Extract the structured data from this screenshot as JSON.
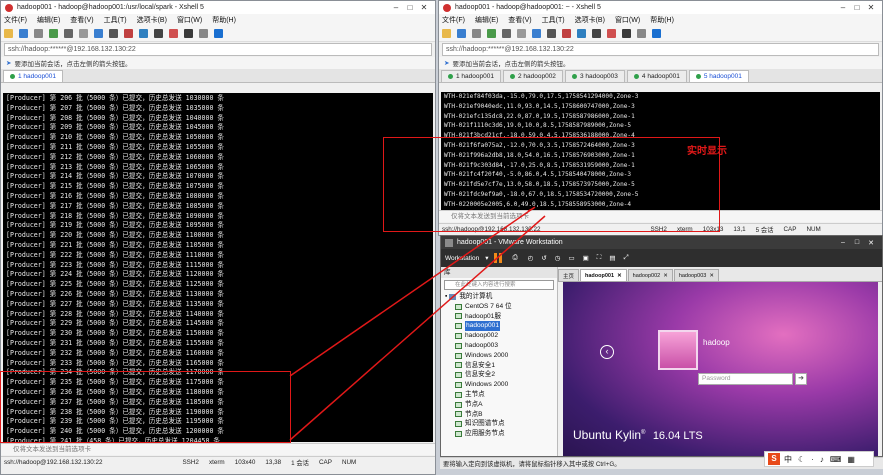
{
  "left_window": {
    "title": "hadoop001 - hadoop@hadoop001:/usr/local/spark - Xshell 5",
    "menu": [
      "文件(F)",
      "编辑(E)",
      "查看(V)",
      "工具(T)",
      "选项卡(B)",
      "窗口(W)",
      "帮助(H)"
    ],
    "address": "ssh://hadoop:******@192.168.132.130:22",
    "hint": "要添加当前会话，点击左侧的箭头按钮。",
    "tab_label": "1 hadoop001",
    "lines": [
      "[Producer] 第 206 批（5000 条）已提交，历史总发送 1030000 条",
      "[Producer] 第 207 批（5000 条）已提交，历史总发送 1035000 条",
      "[Producer] 第 208 批（5000 条）已提交，历史总发送 1040000 条",
      "[Producer] 第 209 批（5000 条）已提交，历史总发送 1045000 条",
      "[Producer] 第 210 批（5000 条）已提交，历史总发送 1050000 条",
      "[Producer] 第 211 批（5000 条）已提交，历史总发送 1055000 条",
      "[Producer] 第 212 批（5000 条）已提交，历史总发送 1060000 条",
      "[Producer] 第 213 批（5000 条）已提交，历史总发送 1065000 条",
      "[Producer] 第 214 批（5000 条）已提交，历史总发送 1070000 条",
      "[Producer] 第 215 批（5000 条）已提交，历史总发送 1075000 条",
      "[Producer] 第 216 批（5000 条）已提交，历史总发送 1080000 条",
      "[Producer] 第 217 批（5000 条）已提交，历史总发送 1085000 条",
      "[Producer] 第 218 批（5000 条）已提交，历史总发送 1090000 条",
      "[Producer] 第 219 批（5000 条）已提交，历史总发送 1095000 条",
      "[Producer] 第 220 批（5000 条）已提交，历史总发送 1100000 条",
      "[Producer] 第 221 批（5000 条）已提交，历史总发送 1105000 条",
      "[Producer] 第 222 批（5000 条）已提交，历史总发送 1110000 条",
      "[Producer] 第 223 批（5000 条）已提交，历史总发送 1115000 条",
      "[Producer] 第 224 批（5000 条）已提交，历史总发送 1120000 条",
      "[Producer] 第 225 批（5000 条）已提交，历史总发送 1125000 条",
      "[Producer] 第 226 批（5000 条）已提交，历史总发送 1130000 条",
      "[Producer] 第 227 批（5000 条）已提交，历史总发送 1135000 条",
      "[Producer] 第 228 批（5000 条）已提交，历史总发送 1140000 条",
      "[Producer] 第 229 批（5000 条）已提交，历史总发送 1145000 条",
      "[Producer] 第 230 批（5000 条）已提交，历史总发送 1150000 条",
      "[Producer] 第 231 批（5000 条）已提交，历史总发送 1155000 条",
      "[Producer] 第 232 批（5000 条）已提交，历史总发送 1160000 条",
      "[Producer] 第 233 批（5000 条）已提交，历史总发送 1165000 条",
      "[Producer] 第 234 批（5000 条）已提交，历史总发送 1170000 条",
      "[Producer] 第 235 批（5000 条）已提交，历史总发送 1175000 条",
      "[Producer] 第 236 批（5000 条）已提交，历史总发送 1180000 条",
      "[Producer] 第 237 批（5000 条）已提交，历史总发送 1185000 条",
      "[Producer] 第 238 批（5000 条）已提交，历史总发送 1190000 条",
      "[Producer] 第 239 批（5000 条）已提交，历史总发送 1195000 条",
      "[Producer] 第 240 批（5000 条）已提交，历史总发送 1200000 条",
      "[Producer] 第 241 批（458 条）已提交，历史总发送 1204458 条",
      "[Producer] 已无数据，等待 1 秒后重Pb...",
      "[Producer] 第 242 批（5000 条）已提交，历史总发送 1205458 条",
      "[Producer] 第 243 批（5000 条）已提交，历史总发送 1210458 条",
      "^Chadoop@hadoop001:/usr/local/spark$ ▯"
    ],
    "input_hint": "仅将文本发送到当前选项卡",
    "status": [
      "ssh://hadoop@192.168.132.130:22",
      "SSH2",
      "xterm",
      "103x40",
      "13,38",
      "1 会话",
      "CAP",
      "NUM"
    ]
  },
  "right_window": {
    "title": "hadoop001 - hadoop@hadoop001: ~ - Xshell 5",
    "menu": [
      "文件(F)",
      "编辑(E)",
      "查看(V)",
      "工具(T)",
      "选项卡(B)",
      "窗口(W)",
      "帮助(H)"
    ],
    "address": "ssh://hadoop:******@192.168.132.130:22",
    "hint": "要添加当前会话，点击左侧的箭头按钮。",
    "tabs": [
      "1 hadoop001",
      "2 hadoop002",
      "3 hadoop003",
      "4 hadoop001",
      "5 hadoop001"
    ],
    "lines": [
      "WTH-021ef84f03da,-15.0,79.0,17.5,1758541294000,Zone-3",
      "WTH-021ef9040edc,11.0,93.0,14.5,1758600747000,Zone-3",
      "WTH-021efc135dc8,22.0,87.0,19.5,1758587986000,Zone-1",
      "WTH-021f1110c3d6,19.0,10.0,8.5,1758587989000,Zone-5",
      "WTH-021f3bcd21cf,-18.0,59.0,4.5,1758536188000,Zone-4",
      "WTH-021f6fa075a2,-12.0,70.0,3.5,1758572464000,Zone-3",
      "WTH-021f996a2db8,18.0,54.0,16.5,1758576903000,Zone-1",
      "WTH-021f9c303d84,-17.0,25.0,8.5,1758531959000,Zone-1",
      "WTH-021fc4f20f40,-5.0,86.0,4.5,1758540478000,Zone-3",
      "WTH-021fd5e7cf7e,13.0,58.0,18.5,1758573975000,Zone-5",
      "WTH-021fdc9ef9a0,-18.0,67.0,18.5,1758534720000,Zone-5",
      "WTH-0220005e2005,6.0,49.0,18.5,1758558953000,Zone-4",
      "▯"
    ],
    "input_hint": "仅将文本发送到当前选项卡",
    "status": [
      "ssh://hadoop@192.168.132.130:22",
      "SSH2",
      "xterm",
      "103x13",
      "13,1",
      "5 会话",
      "CAP",
      "NUM"
    ]
  },
  "annotation": "实时显示",
  "vmware": {
    "title": "hadoop001 - VMware Workstation",
    "menu_label": "Workstation",
    "library_label": "库",
    "search_placeholder": "在此处键入内容进行搜索",
    "tree_root": "我的计算机",
    "tree": [
      "CentOS 7 64 位",
      "hadoop01服",
      "hadoop001",
      "hadoop002",
      "hadoop003",
      "Windows 2000",
      "信息安全1",
      "信息安全2",
      "Windows 2000",
      "主节点",
      "节点A",
      "节点B",
      "知识图谱节点",
      "应用服务节点"
    ],
    "tabs": [
      "主页",
      "hadoop001",
      "hadoop002",
      "hadoop003"
    ],
    "login_user": "hadoop",
    "password_placeholder": "Password",
    "os_brand": "Ubuntu Kylin",
    "os_version": "16.04 LTS",
    "status_msg": "要将输入定向到该虚拟机，请将鼠标指针移入其中或按 Ctrl+G。"
  },
  "taskbar": {
    "ime": "中"
  }
}
